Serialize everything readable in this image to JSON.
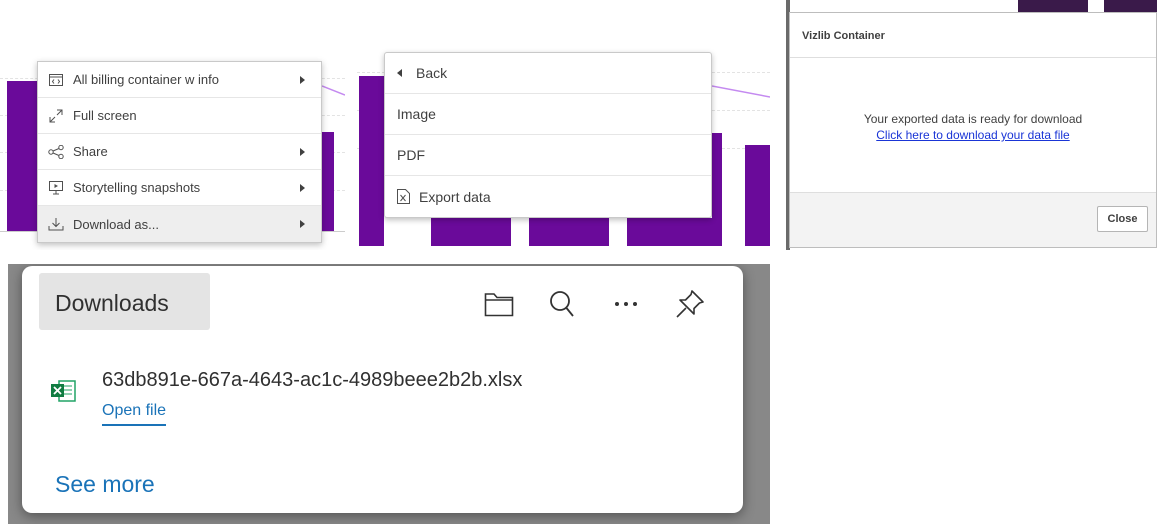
{
  "colors": {
    "bar": "#6a0a9a",
    "line": "#c48af0",
    "link": "#1a35d6",
    "edge_link": "#1a73b8"
  },
  "context_menu": {
    "items": [
      {
        "label": "All billing container w info",
        "icon": "code-icon",
        "submenu": true
      },
      {
        "label": "Full screen",
        "icon": "expand-icon",
        "submenu": false
      },
      {
        "label": "Share",
        "icon": "share-icon",
        "submenu": true
      },
      {
        "label": "Storytelling snapshots",
        "icon": "presentation-icon",
        "submenu": true
      },
      {
        "label": "Download as...",
        "icon": "download-icon",
        "submenu": true,
        "highlighted": true
      }
    ]
  },
  "export_menu": {
    "back": "Back",
    "items": [
      {
        "label": "Image"
      },
      {
        "label": "PDF"
      },
      {
        "label": "Export data",
        "icon": "excel-file-icon"
      }
    ]
  },
  "dialog": {
    "title": "Vizlib Container",
    "message": "Your exported data is ready for download",
    "link": "Click here to download your data file",
    "close_label": "Close"
  },
  "downloads": {
    "title": "Downloads",
    "toolbar_icons": [
      "folder-icon",
      "search-icon",
      "more-icon",
      "pin-icon"
    ],
    "file": {
      "name": "63db891e-667a-4643-ac1c-4989beee2b2b.xlsx",
      "action": "Open file"
    },
    "see_more": "See more"
  }
}
